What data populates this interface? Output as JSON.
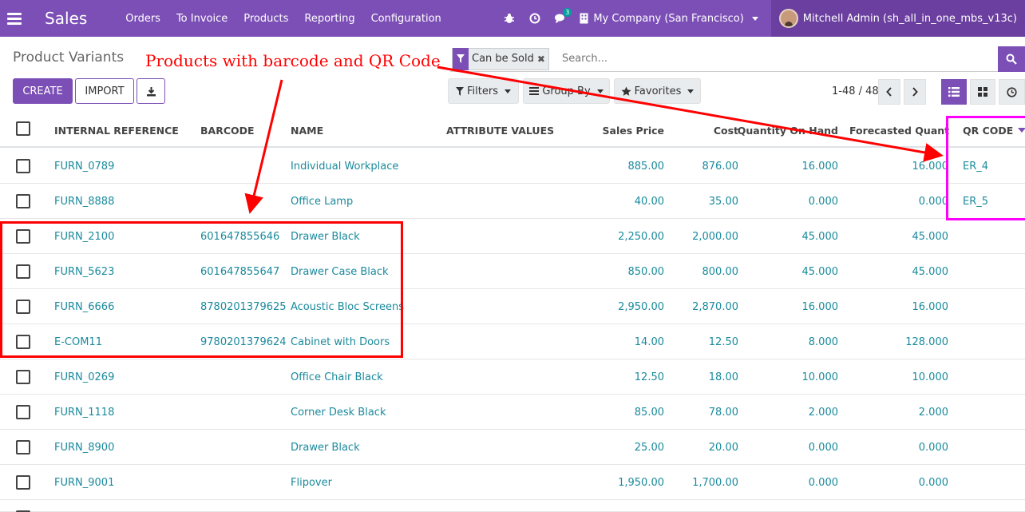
{
  "nav": {
    "brand": "Sales",
    "menu": [
      "Orders",
      "To Invoice",
      "Products",
      "Reporting",
      "Configuration"
    ],
    "chat_badge": "3",
    "company": "My Company (San Francisco)",
    "user": "Mitchell Admin (sh_all_in_one_mbs_v13c)"
  },
  "control": {
    "breadcrumb": "Product Variants",
    "create_label": "CREATE",
    "import_label": "IMPORT",
    "facet_label": "Can be Sold",
    "search_placeholder": "Search...",
    "filters_label": "Filters",
    "groupby_label": "Group By",
    "favorites_label": "Favorites",
    "pager": "1-48 / 48"
  },
  "table": {
    "headers": {
      "ref": "INTERNAL REFERENCE",
      "barcode": "BARCODE",
      "name": "NAME",
      "attributes": "ATTRIBUTE VALUES",
      "sales_price": "Sales Price",
      "cost": "Cost",
      "qty_on_hand": "Quantity On Hand",
      "forecasted": "Forecasted Quantity",
      "qr_code": "QR CODE"
    },
    "rows": [
      {
        "ref": "FURN_0789",
        "barcode": "",
        "name": "Individual Workplace",
        "price": "885.00",
        "cost": "876.00",
        "qty": "16.000",
        "forecast": "16.000",
        "qr": "ER_4"
      },
      {
        "ref": "FURN_8888",
        "barcode": "",
        "name": "Office Lamp",
        "price": "40.00",
        "cost": "35.00",
        "qty": "0.000",
        "forecast": "0.000",
        "qr": "ER_5"
      },
      {
        "ref": "FURN_2100",
        "barcode": "601647855646",
        "name": "Drawer Black",
        "price": "2,250.00",
        "cost": "2,000.00",
        "qty": "45.000",
        "forecast": "45.000",
        "qr": ""
      },
      {
        "ref": "FURN_5623",
        "barcode": "601647855647",
        "name": "Drawer Case Black",
        "price": "850.00",
        "cost": "800.00",
        "qty": "45.000",
        "forecast": "45.000",
        "qr": ""
      },
      {
        "ref": "FURN_6666",
        "barcode": "8780201379625",
        "name": "Acoustic Bloc Screens",
        "price": "2,950.00",
        "cost": "2,870.00",
        "qty": "16.000",
        "forecast": "16.000",
        "qr": ""
      },
      {
        "ref": "E-COM11",
        "barcode": "9780201379624",
        "name": "Cabinet with Doors",
        "price": "14.00",
        "cost": "12.50",
        "qty": "8.000",
        "forecast": "128.000",
        "qr": ""
      },
      {
        "ref": "FURN_0269",
        "barcode": "",
        "name": "Office Chair Black",
        "price": "12.50",
        "cost": "18.00",
        "qty": "10.000",
        "forecast": "10.000",
        "qr": ""
      },
      {
        "ref": "FURN_1118",
        "barcode": "",
        "name": "Corner Desk Black",
        "price": "85.00",
        "cost": "78.00",
        "qty": "2.000",
        "forecast": "2.000",
        "qr": ""
      },
      {
        "ref": "FURN_8900",
        "barcode": "",
        "name": "Drawer Black",
        "price": "25.00",
        "cost": "20.00",
        "qty": "0.000",
        "forecast": "0.000",
        "qr": ""
      },
      {
        "ref": "FURN_9001",
        "barcode": "",
        "name": "Flipover",
        "price": "1,950.00",
        "cost": "1,700.00",
        "qty": "0.000",
        "forecast": "0.000",
        "qr": ""
      }
    ]
  },
  "annotation": {
    "text": "Products with barcode and QR Code",
    "color": "#ff0000",
    "highlight_color": "#ff00ff"
  },
  "theme": {
    "primary": "#7c4fb6",
    "link": "#1a8a9c"
  }
}
